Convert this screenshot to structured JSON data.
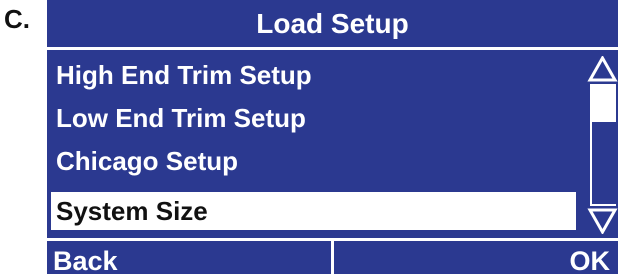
{
  "figure_label": "C.",
  "screen": {
    "title": "Load Setup",
    "menu_items": [
      {
        "label": "High End Trim Setup",
        "selected": false
      },
      {
        "label": "Low End Trim Setup",
        "selected": false
      },
      {
        "label": "Chicago Setup",
        "selected": false
      },
      {
        "label": "System Size",
        "selected": true
      }
    ],
    "scrollbar": {
      "up_icon": "triangle-up-icon",
      "down_icon": "triangle-down-icon"
    },
    "softkeys": {
      "back": "Back",
      "ok": "OK"
    }
  },
  "colors": {
    "screen_background": "#2b3990",
    "text": "#ffffff",
    "selected_background": "#ffffff",
    "selected_text": "#111111"
  }
}
